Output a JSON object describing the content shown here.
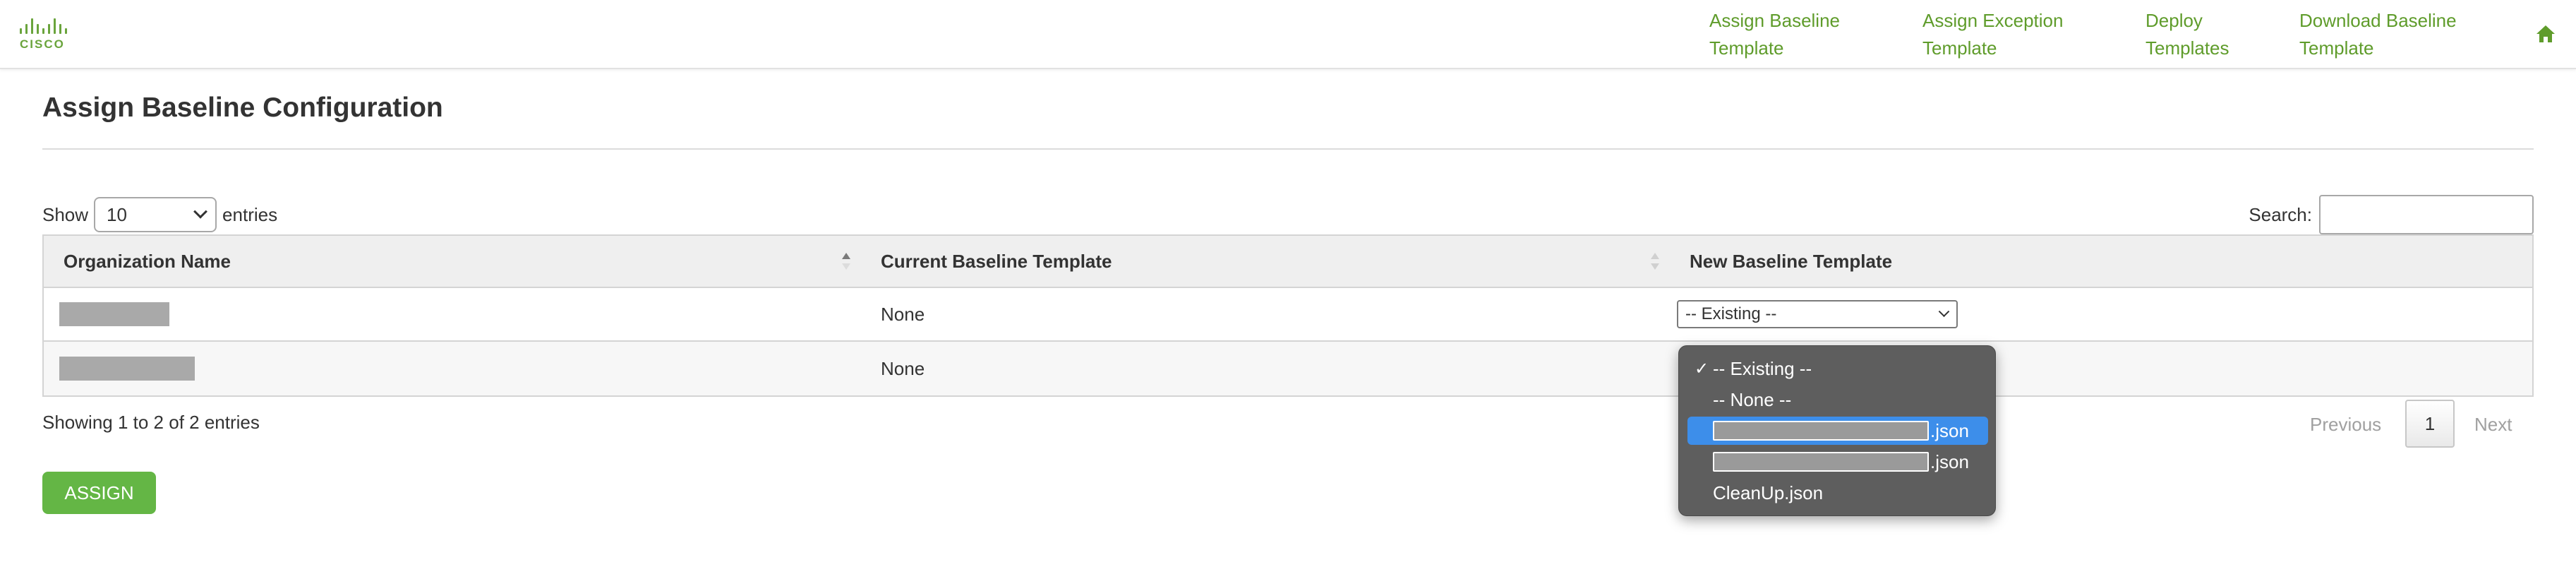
{
  "header": {
    "logo_text": "CISCO",
    "nav": [
      {
        "line1": "Assign Baseline",
        "line2": "Template"
      },
      {
        "line1": "Assign Exception",
        "line2": "Template"
      },
      {
        "line1": "Deploy",
        "line2": "Templates"
      },
      {
        "line1": "Download Baseline",
        "line2": "Template"
      }
    ],
    "home_icon": "home-icon"
  },
  "page": {
    "title": "Assign Baseline Configuration"
  },
  "length_menu": {
    "prefix": "Show",
    "value": "10",
    "suffix": "entries"
  },
  "search": {
    "label": "Search:",
    "value": ""
  },
  "table": {
    "columns": [
      "Organization Name",
      "Current Baseline Template",
      "New Baseline Template"
    ],
    "rows": [
      {
        "org": "",
        "current": "None",
        "new": "-- Existing --"
      },
      {
        "org": "",
        "current": "None",
        "new": "-- Existing --"
      }
    ]
  },
  "info": "Showing 1 to 2 of 2 entries",
  "pagination": {
    "previous": "Previous",
    "current": "1",
    "next": "Next"
  },
  "assign_button": "ASSIGN",
  "dropdown": {
    "selected_check": "✓",
    "options": [
      {
        "label": "-- Existing --",
        "selected": true
      },
      {
        "label": "-- None --"
      },
      {
        "suffix": ".json",
        "highlighted": true
      },
      {
        "suffix": ".json"
      },
      {
        "label": "CleanUp.json"
      }
    ]
  },
  "colors": {
    "brand_green": "#5f9c2b",
    "button_green": "#64b645",
    "highlight_blue": "#3d8eea",
    "popup_bg": "#5e5e5e"
  }
}
